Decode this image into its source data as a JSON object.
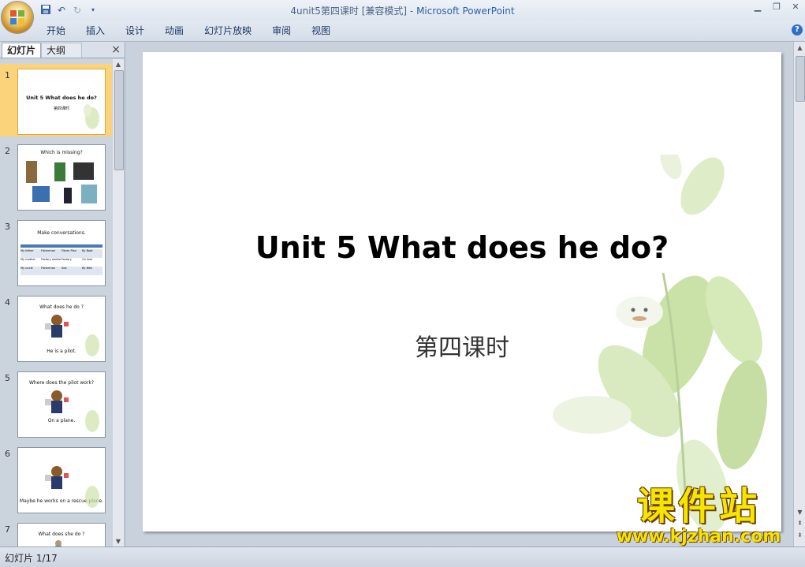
{
  "window": {
    "title_doc": "4unit5第四课时 [兼容模式]",
    "title_sep": " - ",
    "title_app": "Microsoft PowerPoint"
  },
  "quick_access": [
    "save-icon",
    "undo-icon",
    "redo-icon",
    "customize-icon"
  ],
  "ribbon_tabs": [
    "开始",
    "插入",
    "设计",
    "动画",
    "幻灯片放映",
    "审阅",
    "视图"
  ],
  "panel": {
    "tab_slides": "幻灯片",
    "tab_outline": "大纲",
    "close": "×"
  },
  "thumbnails": [
    {
      "num": "1",
      "title": "Unit 5 What does he do?",
      "sub": "第四课时",
      "selected": true
    },
    {
      "num": "2",
      "title": "Which is missing?",
      "sub": ""
    },
    {
      "num": "3",
      "title": "Make conversations.",
      "sub": ""
    },
    {
      "num": "4",
      "title": "What does he do ?",
      "sub": "He is a pilot."
    },
    {
      "num": "5",
      "title": "Where does the pilot work?",
      "sub": "On a plane."
    },
    {
      "num": "6",
      "title": "",
      "sub": "Maybe he works on a rescue plane."
    },
    {
      "num": "7",
      "title": "What does she do ?",
      "sub": ""
    }
  ],
  "thumb3_table": [
    [
      "My father",
      "Fisherman",
      "Fisher Plan",
      "By Boat"
    ],
    [
      "My mother",
      "Factory worker",
      "Factory",
      "On foot"
    ],
    [
      "My uncle",
      "Fisherman",
      "Sea",
      "By Bike"
    ]
  ],
  "slide": {
    "title": "Unit 5 What does he do?",
    "subtitle": "第四课时"
  },
  "watermark": {
    "cn": "课件站",
    "url": "www.kjzhan.com"
  },
  "status": {
    "slide_counter": "幻灯片 1/17"
  },
  "colors": {
    "selected_thumb": "#fbd37a",
    "watermark": "#f5e600",
    "leaf": "#b9d98a"
  }
}
